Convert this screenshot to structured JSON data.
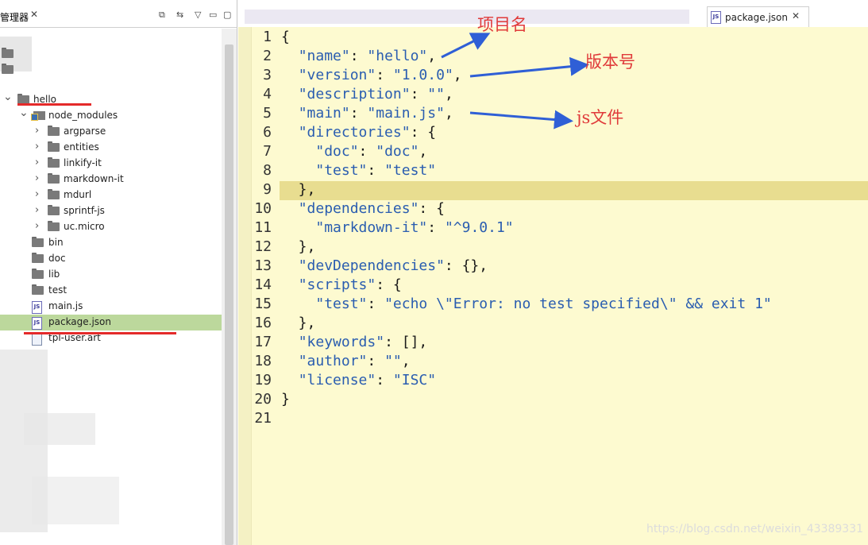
{
  "explorer": {
    "tab_label": "管理器",
    "tree": [
      {
        "name": "hello",
        "type": "folder",
        "expanded": true
      },
      {
        "name": "node_modules",
        "type": "node-modules",
        "expanded": true
      },
      {
        "name": "argparse",
        "type": "folder",
        "expanded": false
      },
      {
        "name": "entities",
        "type": "folder",
        "expanded": false
      },
      {
        "name": "linkify-it",
        "type": "folder",
        "expanded": false
      },
      {
        "name": "markdown-it",
        "type": "folder",
        "expanded": false
      },
      {
        "name": "mdurl",
        "type": "folder",
        "expanded": false
      },
      {
        "name": "sprintf-js",
        "type": "folder",
        "expanded": false
      },
      {
        "name": "uc.micro",
        "type": "folder",
        "expanded": false
      },
      {
        "name": "bin",
        "type": "folder"
      },
      {
        "name": "doc",
        "type": "folder"
      },
      {
        "name": "lib",
        "type": "folder"
      },
      {
        "name": "test",
        "type": "folder"
      },
      {
        "name": "main.js",
        "type": "js-file"
      },
      {
        "name": "package.json",
        "type": "json-file",
        "selected": true
      },
      {
        "name": "tpl-user.art",
        "type": "text-file"
      }
    ]
  },
  "editor": {
    "tab_label": "package.json",
    "lines": [
      "{",
      "  \"name\": \"hello\",",
      "  \"version\": \"1.0.0\",",
      "  \"description\": \"\",",
      "  \"main\": \"main.js\",",
      "  \"directories\": {",
      "    \"doc\": \"doc\",",
      "    \"test\": \"test\"",
      "  },",
      "  \"dependencies\": {",
      "    \"markdown-it\": \"^9.0.1\"",
      "  },",
      "  \"devDependencies\": {},",
      "  \"scripts\": {",
      "    \"test\": \"echo \\\"Error: no test specified\\\" && exit 1\"",
      "  },",
      "  \"keywords\": [],",
      "  \"author\": \"\",",
      "  \"license\": \"ISC\"",
      "}",
      ""
    ],
    "current_line": 9
  },
  "annotations": {
    "project_name": "项目名",
    "version": "版本号",
    "js_file": "js文件"
  },
  "watermark": "https://blog.csdn.net/weixin_43389331",
  "colors": {
    "editor_bg": "#fdfad0",
    "current_line": "#e8dd90",
    "selection": "#bcd89c",
    "annotation_red": "#e03a3a",
    "arrow_blue": "#2f5fd6",
    "underline_red": "#e42a2a"
  }
}
